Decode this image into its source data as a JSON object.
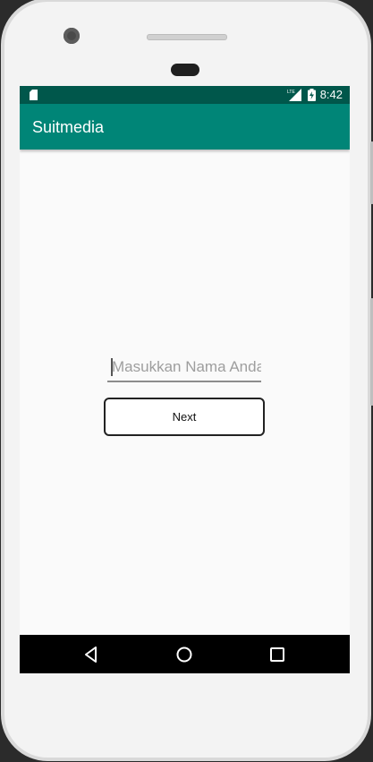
{
  "status_bar": {
    "time": "8:42",
    "network_label": "LTE",
    "icons": [
      "sd-card-icon",
      "lte-signal-icon",
      "battery-charging-icon"
    ]
  },
  "app_bar": {
    "title": "Suitmedia"
  },
  "form": {
    "name_input": {
      "placeholder": "Masukkan Nama Anda",
      "value": ""
    },
    "next_button_label": "Next"
  },
  "navigation": {
    "buttons": [
      "back-icon",
      "home-icon",
      "recents-icon"
    ]
  },
  "colors": {
    "status_bar": "#00574b",
    "app_bar": "#008577",
    "background": "#fafafa",
    "nav_bar": "#000000"
  }
}
